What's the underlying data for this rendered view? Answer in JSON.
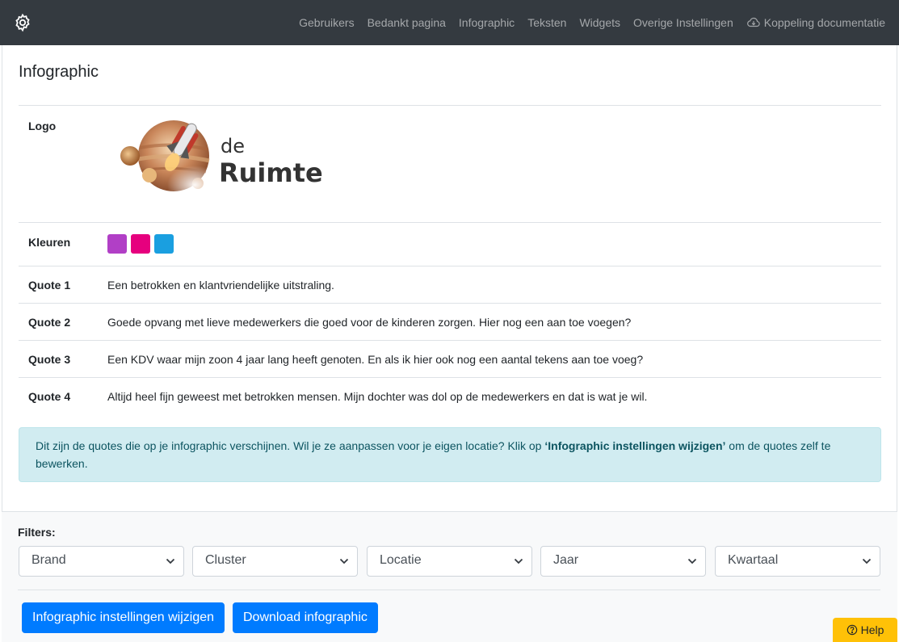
{
  "nav": {
    "items": [
      {
        "label": "Gebruikers"
      },
      {
        "label": "Bedankt pagina"
      },
      {
        "label": "Infographic"
      },
      {
        "label": "Teksten"
      },
      {
        "label": "Widgets"
      },
      {
        "label": "Overige Instellingen"
      },
      {
        "label": "Koppeling documentatie",
        "icon": "cloud-download-icon"
      }
    ]
  },
  "page": {
    "title": "Infographic"
  },
  "settings": {
    "logo_label": "Logo",
    "logo_text_small": "de",
    "logo_text_big": "Ruimte",
    "colors_label": "Kleuren",
    "colors": [
      "#b13fc6",
      "#e6007e",
      "#1a9fe0"
    ],
    "quotes": [
      {
        "label": "Quote 1",
        "text": "Een betrokken en klantvriendelijke uitstraling."
      },
      {
        "label": "Quote 2",
        "text": "Goede opvang met lieve medewerkers die goed voor de kinderen zorgen. Hier nog een aan toe voegen?"
      },
      {
        "label": "Quote 3",
        "text": "Een KDV waar mijn zoon 4 jaar lang heeft genoten. En als ik hier ook nog een aantal tekens aan toe voeg?"
      },
      {
        "label": "Quote 4",
        "text": "Altijd heel fijn geweest met betrokken mensen. Mijn dochter was dol op de medewerkers en dat is wat je wil."
      }
    ]
  },
  "alert": {
    "text_before": "Dit zijn de quotes die op je infographic verschijnen. Wil je ze aanpassen voor je eigen locatie? Klik op ",
    "bold": "‘Infographic instellingen wijzigen’",
    "text_after": " om de quotes zelf te bewerken."
  },
  "filters": {
    "label": "Filters:",
    "selects": [
      {
        "value": "Brand"
      },
      {
        "value": "Cluster"
      },
      {
        "value": "Locatie"
      },
      {
        "value": "Jaar"
      },
      {
        "value": "Kwartaal"
      }
    ]
  },
  "actions": {
    "edit_label": "Infographic instellingen wijzigen",
    "download_label": "Download infographic"
  },
  "help": {
    "label": "Help"
  }
}
